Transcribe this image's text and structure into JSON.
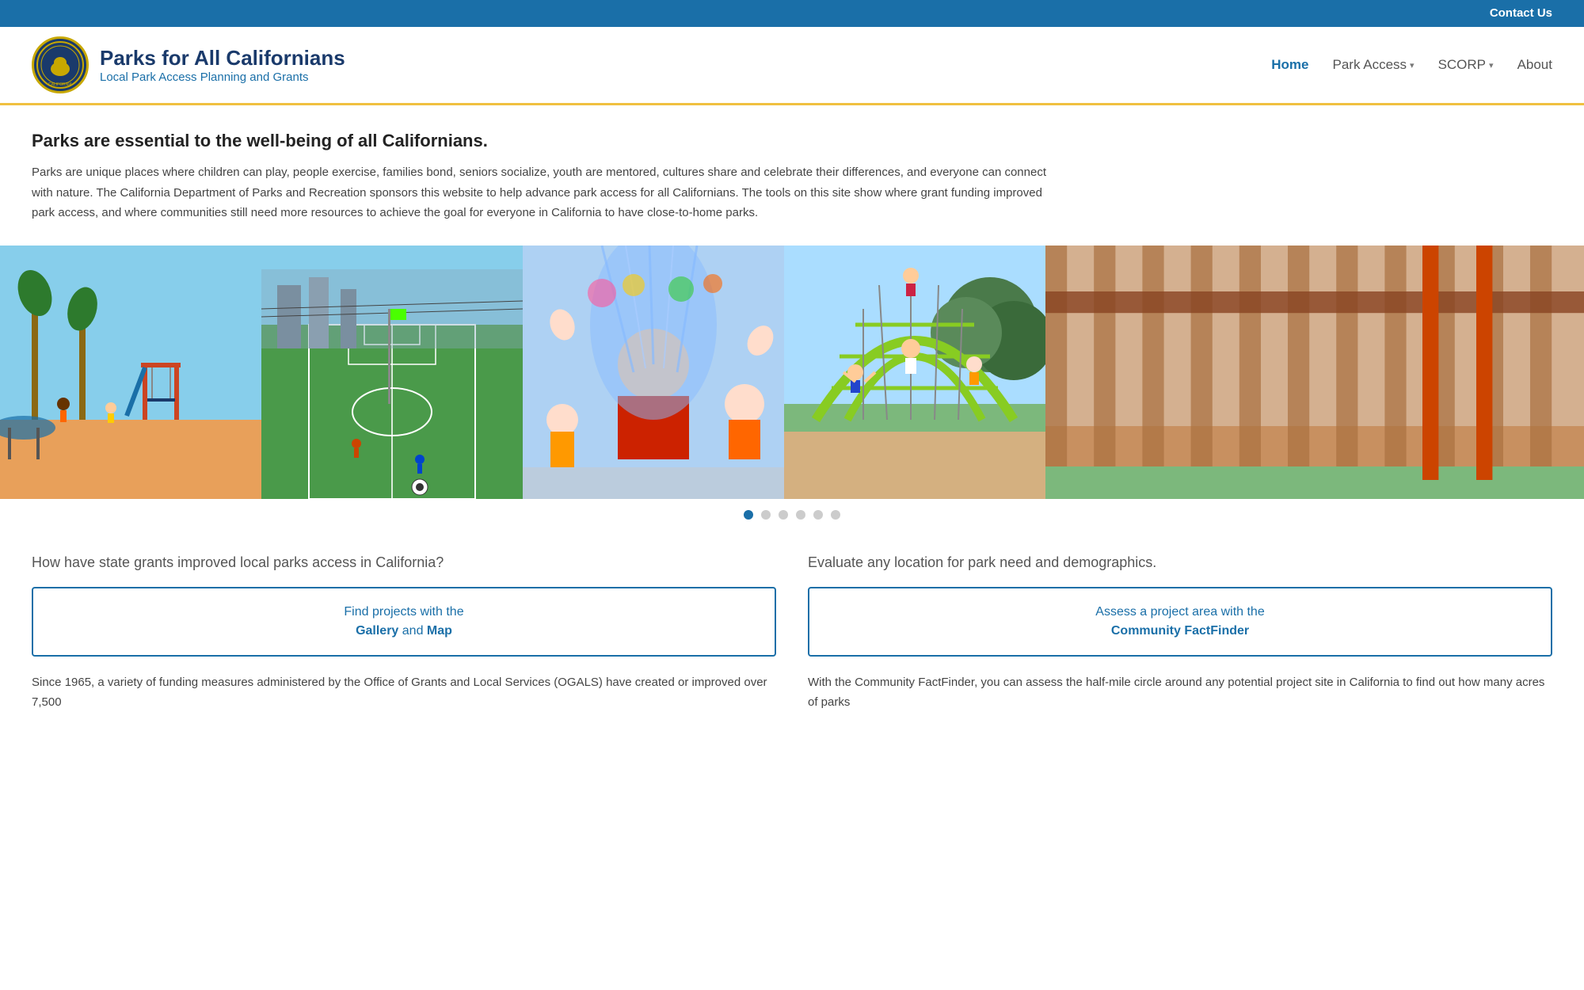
{
  "topbar": {
    "contact_label": "Contact Us"
  },
  "header": {
    "logo_alt": "California State Parks seal",
    "site_title": "Parks for All Californians",
    "site_subtitle": "Local Park Access Planning and Grants",
    "nav": {
      "home": "Home",
      "park_access": "Park Access",
      "scorp": "SCORP",
      "about": "About"
    }
  },
  "main": {
    "intro_heading": "Parks are essential to the well-being of all Californians.",
    "intro_body": "Parks are unique places where children can play, people exercise, families bond, seniors socialize, youth are mentored, cultures share and celebrate their differences, and everyone can connect with nature. The California Department of Parks and Recreation sponsors this website to help advance park access for all Californians. The tools on this site show where grant funding improved park access, and where communities still need more resources to achieve the goal for everyone in California to have close-to-home parks.",
    "photos": [
      {
        "label": "Playground with colorful equipment"
      },
      {
        "label": "Green soccer field"
      },
      {
        "label": "Child playing in water"
      },
      {
        "label": "Kids on climbing structure"
      },
      {
        "label": "Park area"
      }
    ],
    "carousel_dots": [
      "active",
      "",
      "",
      "",
      "",
      ""
    ],
    "left_col": {
      "question": "How have state grants improved local parks access in California?",
      "cta_line1": "Find projects with the",
      "cta_bold1": "Gallery",
      "cta_and": " and ",
      "cta_bold2": "Map",
      "body": "Since 1965, a variety of funding measures administered by the Office of Grants and Local Services (OGALS) have created or improved over 7,500"
    },
    "right_col": {
      "question": "Evaluate any location for park need and demographics.",
      "cta_line1": "Assess a project area with the",
      "cta_bold": "Community FactFinder",
      "body": "With the Community FactFinder, you can assess the half-mile circle around any potential project site in California to find out how many acres of parks"
    }
  }
}
